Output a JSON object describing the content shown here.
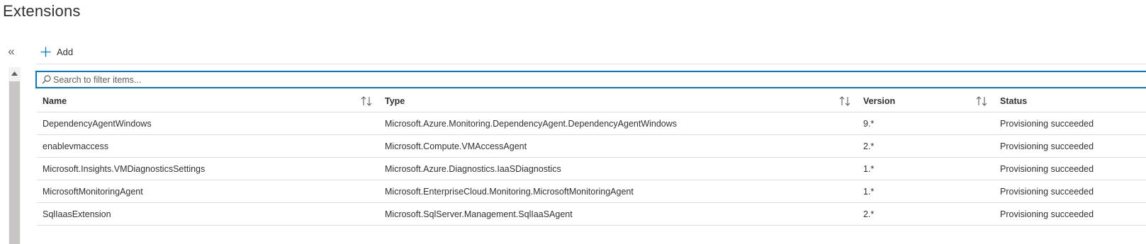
{
  "page": {
    "title": "Extensions"
  },
  "nav": {
    "collapse_glyph": "«"
  },
  "toolbar": {
    "add_label": "Add",
    "add_icon": "plus-icon"
  },
  "search": {
    "placeholder": "Search to filter items...",
    "value": ""
  },
  "table": {
    "headers": {
      "name": "Name",
      "type": "Type",
      "version": "Version",
      "status": "Status"
    },
    "rows": [
      {
        "name": "DependencyAgentWindows",
        "type": "Microsoft.Azure.Monitoring.DependencyAgent.DependencyAgentWindows",
        "version": "9.*",
        "status": "Provisioning succeeded"
      },
      {
        "name": "enablevmaccess",
        "type": "Microsoft.Compute.VMAccessAgent",
        "version": "2.*",
        "status": "Provisioning succeeded"
      },
      {
        "name": "Microsoft.Insights.VMDiagnosticsSettings",
        "type": "Microsoft.Azure.Diagnostics.IaaSDiagnostics",
        "version": "1.*",
        "status": "Provisioning succeeded"
      },
      {
        "name": "MicrosoftMonitoringAgent",
        "type": "Microsoft.EnterpriseCloud.Monitoring.MicrosoftMonitoringAgent",
        "version": "1.*",
        "status": "Provisioning succeeded"
      },
      {
        "name": "SqlIaasExtension",
        "type": "Microsoft.SqlServer.Management.SqlIaaSAgent",
        "version": "2.*",
        "status": "Provisioning succeeded"
      }
    ]
  },
  "colors": {
    "accent": "#0078d4",
    "text": "#323130",
    "divider": "#e1dfdd",
    "scroll_thumb": "#c8c6c4"
  }
}
